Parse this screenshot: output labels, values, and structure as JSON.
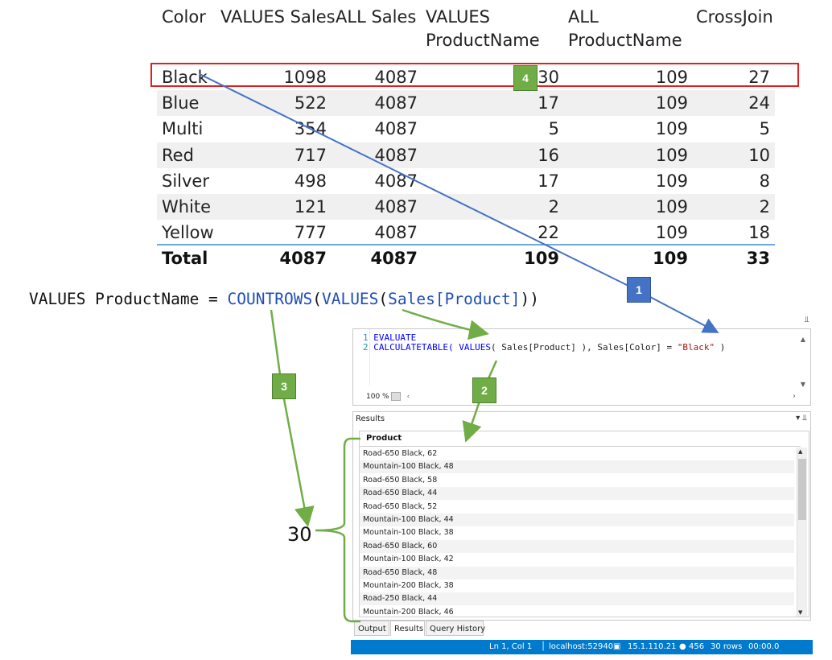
{
  "pivot": {
    "headers": [
      "Color",
      "VALUES Sales",
      "ALL Sales",
      "VALUES\nProductName",
      "ALL\nProductName",
      "CrossJoin"
    ],
    "header_col3_line1": "VALUES",
    "header_col3_line2": "ProductName",
    "header_col4_line1": "ALL",
    "header_col4_line2": "ProductName",
    "rows": [
      {
        "color": "Black",
        "values_sales": "1098",
        "all_sales": "4087",
        "values_productname": "30",
        "all_productname": "109",
        "crossjoin": "27"
      },
      {
        "color": "Blue",
        "values_sales": "522",
        "all_sales": "4087",
        "values_productname": "17",
        "all_productname": "109",
        "crossjoin": "24"
      },
      {
        "color": "Multi",
        "values_sales": "354",
        "all_sales": "4087",
        "values_productname": "5",
        "all_productname": "109",
        "crossjoin": "5"
      },
      {
        "color": "Red",
        "values_sales": "717",
        "all_sales": "4087",
        "values_productname": "16",
        "all_productname": "109",
        "crossjoin": "10"
      },
      {
        "color": "Silver",
        "values_sales": "498",
        "all_sales": "4087",
        "values_productname": "17",
        "all_productname": "109",
        "crossjoin": "8"
      },
      {
        "color": "White",
        "values_sales": "121",
        "all_sales": "4087",
        "values_productname": "2",
        "all_productname": "109",
        "crossjoin": "2"
      },
      {
        "color": "Yellow",
        "values_sales": "777",
        "all_sales": "4087",
        "values_productname": "22",
        "all_productname": "109",
        "crossjoin": "18"
      }
    ],
    "total": {
      "color": "Total",
      "values_sales": "4087",
      "all_sales": "4087",
      "values_productname": "109",
      "all_productname": "109",
      "crossjoin": "33"
    }
  },
  "formula": {
    "lhs": "VALUES ProductName = ",
    "fn1": "COUNTROWS",
    "p1": "(",
    "fn2": "VALUES",
    "p2": "(",
    "arg": "Sales[Product]",
    "p3": "))"
  },
  "callouts": {
    "b1": "1",
    "b2": "2",
    "b3": "3",
    "b4": "4",
    "count": "30"
  },
  "editor": {
    "line1_no": "1",
    "line1_code": "EVALUATE",
    "line2_no": "2",
    "line2_a": "CALCULATETABLE( ",
    "line2_kw": "VALUES",
    "line2_b": "( Sales[Product] ), Sales[Color] = ",
    "line2_str": "\"Black\"",
    "line2_c": " )",
    "zoom": "100 %"
  },
  "results": {
    "title": "Results",
    "column": "Product",
    "rows": [
      "Road-650 Black, 62",
      "Mountain-100 Black, 48",
      "Road-650 Black, 58",
      "Road-650 Black, 44",
      "Road-650 Black, 52",
      "Mountain-100 Black, 44",
      "Mountain-100 Black, 38",
      "Road-650 Black, 60",
      "Mountain-100 Black, 42",
      "Road-650 Black, 48",
      "Mountain-200 Black, 38",
      "Road-250 Black, 44",
      "Mountain-200 Black, 46"
    ]
  },
  "tabs": [
    "Output",
    "Results",
    "Query History"
  ],
  "status": {
    "position": "Ln 1, Col 1",
    "server": "localhost:52940",
    "version": "15.1.110.21",
    "users": "456",
    "rows": "30 rows",
    "time": "00:00.0"
  },
  "colors": {
    "accent_blue": "#4472c4",
    "accent_green": "#70ad47",
    "highlight_red": "#e02020",
    "status_blue": "#007acc"
  }
}
